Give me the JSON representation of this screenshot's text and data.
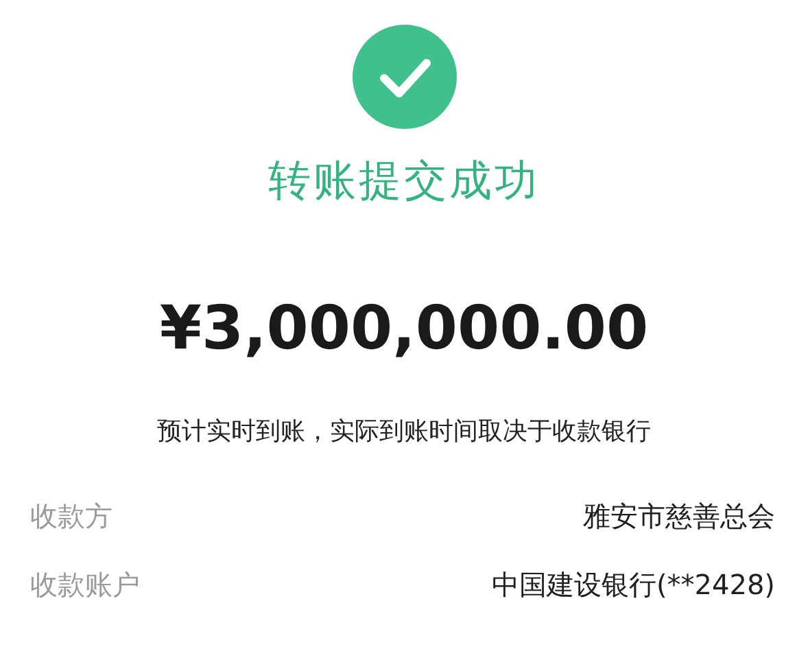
{
  "status": {
    "title": "转账提交成功",
    "amount": "¥3,000,000.00",
    "note": "预计实时到账，实际到账时间取决于收款银行"
  },
  "details": [
    {
      "label": "收款方",
      "value": "雅安市慈善总会"
    },
    {
      "label": "收款账户",
      "value": "中国建设银行(**2428)"
    }
  ]
}
